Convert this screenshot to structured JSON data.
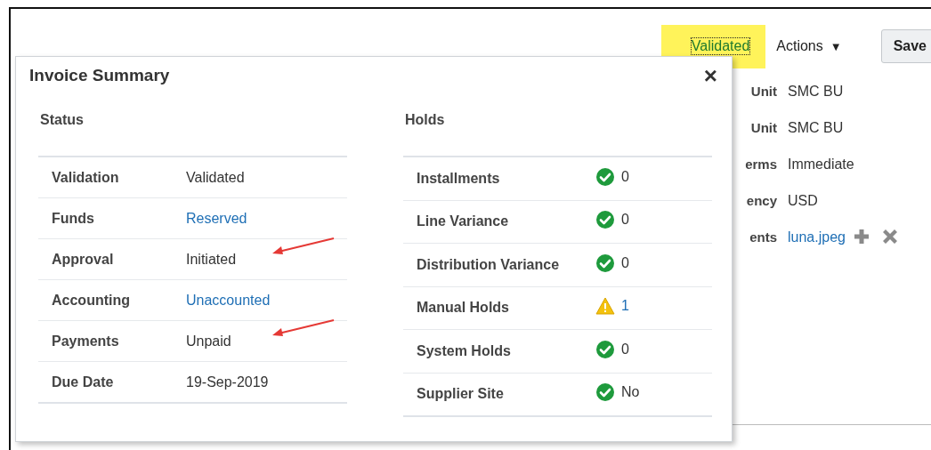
{
  "header": {
    "status": {
      "label": "Validated",
      "highlighted": true
    },
    "actions": "Actions",
    "actions_caret": "▼",
    "save": "Save"
  },
  "fields": [
    {
      "label": "Unit",
      "value": "SMC BU",
      "link": false
    },
    {
      "label": "Unit",
      "value": "SMC BU",
      "link": false
    },
    {
      "label": "erms",
      "value": "Immediate",
      "link": false
    },
    {
      "label": "ency",
      "value": "USD",
      "link": false
    },
    {
      "label": "ents",
      "value": "luna.jpeg",
      "link": true,
      "attachment_actions": true
    }
  ],
  "popup": {
    "title": "Invoice Summary",
    "close": "×",
    "status": {
      "heading": "Status",
      "rows": [
        {
          "label": "Validation",
          "value": "Validated",
          "link": false,
          "annotated": false
        },
        {
          "label": "Funds",
          "value": "Reserved",
          "link": true,
          "annotated": false
        },
        {
          "label": "Approval",
          "value": "Initiated",
          "link": false,
          "annotated": true
        },
        {
          "label": "Accounting",
          "value": "Unaccounted",
          "link": true,
          "annotated": false
        },
        {
          "label": "Payments",
          "value": "Unpaid",
          "link": false,
          "annotated": true
        },
        {
          "label": "Due Date",
          "value": "19-Sep-2019",
          "link": false,
          "annotated": false
        }
      ]
    },
    "holds": {
      "heading": "Holds",
      "rows": [
        {
          "label": "Installments",
          "value": "0",
          "kind": "ok",
          "link": false
        },
        {
          "label": "Line Variance",
          "value": "0",
          "kind": "ok",
          "link": false
        },
        {
          "label": "Distribution Variance",
          "value": "0",
          "kind": "ok",
          "link": false
        },
        {
          "label": "Manual Holds",
          "value": "1",
          "kind": "warning",
          "link": true
        },
        {
          "label": "System Holds",
          "value": "0",
          "kind": "ok",
          "link": false
        },
        {
          "label": "Supplier Site",
          "value": "No",
          "kind": "ok",
          "link": false
        }
      ]
    }
  }
}
